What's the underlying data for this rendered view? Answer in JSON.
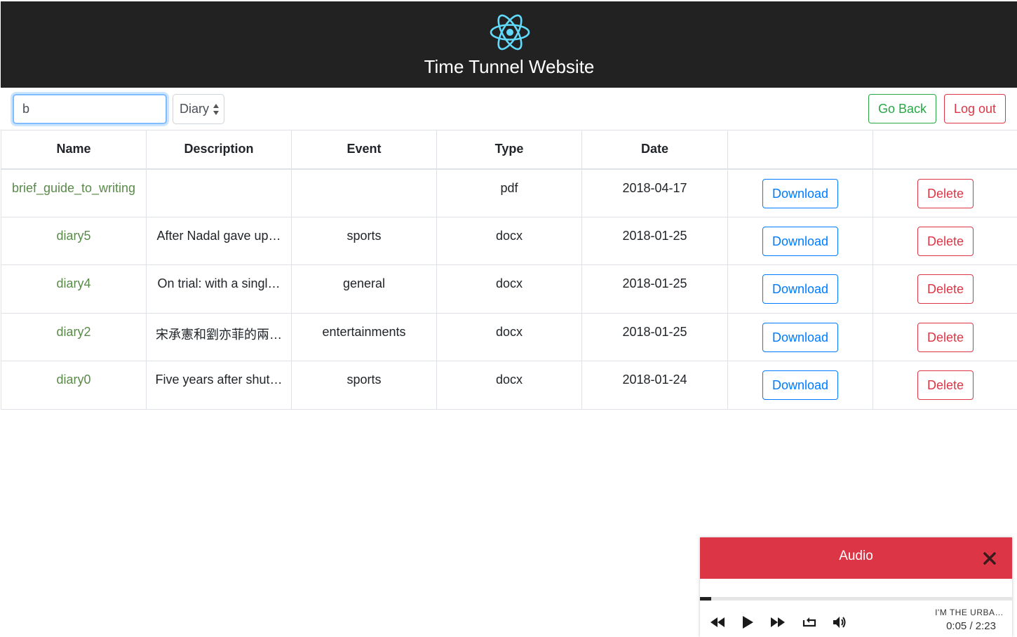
{
  "header": {
    "title": "Time Tunnel Website",
    "logo_icon": "react-atom-icon",
    "logo_color": "#61dafb"
  },
  "toolbar": {
    "search_value": "b",
    "select_value": "Diary",
    "go_back_label": "Go Back",
    "logout_label": "Log out"
  },
  "table": {
    "columns": [
      "Name",
      "Description",
      "Event",
      "Type",
      "Date",
      "",
      ""
    ],
    "rows": [
      {
        "name": "brief_guide_to_writing",
        "description": "",
        "event": "",
        "type": "pdf",
        "date": "2018-04-17",
        "download": "Download",
        "delete": "Delete"
      },
      {
        "name": "diary5",
        "description": "After Nadal gave up…",
        "event": "sports",
        "type": "docx",
        "date": "2018-01-25",
        "download": "Download",
        "delete": "Delete"
      },
      {
        "name": "diary4",
        "description": "On trial: with a singl…",
        "event": "general",
        "type": "docx",
        "date": "2018-01-25",
        "download": "Download",
        "delete": "Delete"
      },
      {
        "name": "diary2",
        "description": "宋承憲和劉亦菲的兩…",
        "event": "entertainments",
        "type": "docx",
        "date": "2018-01-25",
        "download": "Download",
        "delete": "Delete"
      },
      {
        "name": "diary0",
        "description": "Five years after shut…",
        "event": "sports",
        "type": "docx",
        "date": "2018-01-24",
        "download": "Download",
        "delete": "Delete"
      }
    ]
  },
  "audio": {
    "title": "Audio",
    "track": "I'M THE URBA…",
    "current_time": "0:05",
    "separator": "/",
    "duration": "2:23",
    "progress_fraction": 0.035,
    "header_color": "#dc3545"
  }
}
